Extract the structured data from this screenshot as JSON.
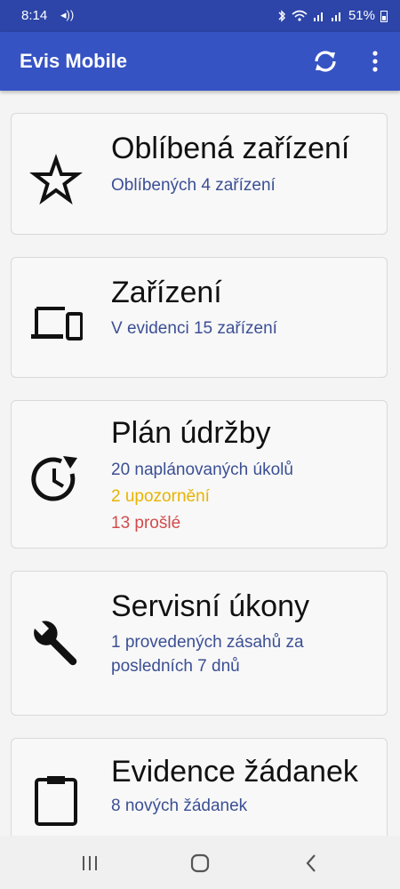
{
  "status": {
    "time": "8:14",
    "battery": "51%"
  },
  "appbar": {
    "title": "Evis Mobile"
  },
  "cards": [
    {
      "title": "Oblíbená zařízení",
      "lines": [
        "Oblíbených 4 zařízení"
      ]
    },
    {
      "title": "Zařízení",
      "lines": [
        "V evidenci 15 zařízení"
      ]
    },
    {
      "title": "Plán údržby",
      "lines": [
        "20 naplánovaných úkolů",
        "2 upozornění",
        "13 prošlé"
      ]
    },
    {
      "title": "Servisní úkony",
      "lines": [
        "1 provedených zásahů za posledních 7 dnů"
      ]
    },
    {
      "title": "Evidence žádanek",
      "lines": [
        "8 nových žádanek"
      ]
    }
  ],
  "icons": [
    "star-icon",
    "devices-icon",
    "schedule-icon",
    "wrench-icon",
    "clipboard-icon"
  ],
  "colors": {
    "appbar": "#3653c4",
    "statusbar": "#2d45a8",
    "subtitle": "#3b4f94",
    "warning": "#e8b300",
    "expired": "#d24b4b"
  }
}
